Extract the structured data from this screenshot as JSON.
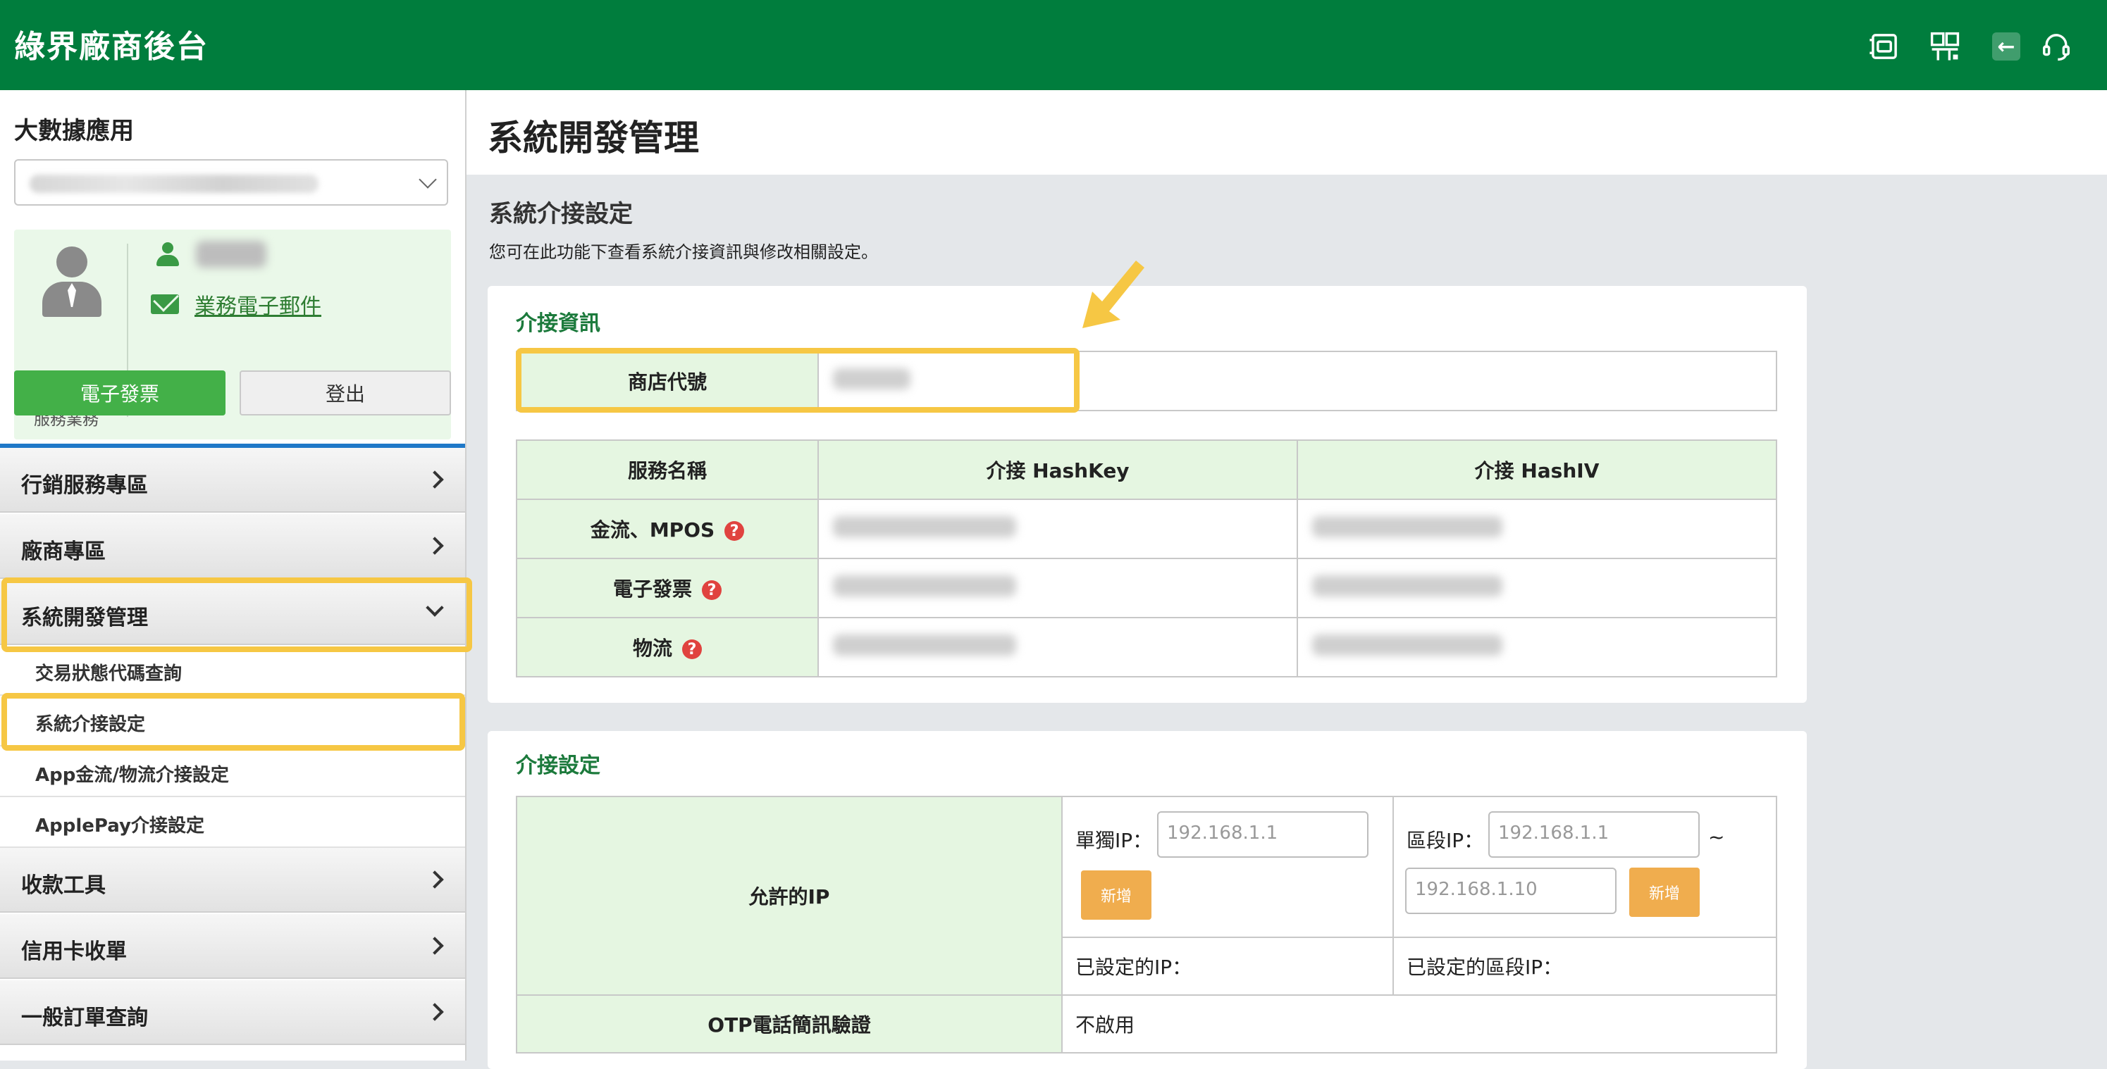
{
  "header": {
    "brand": "綠界廠商後台",
    "icons": [
      "invoice-app-icon",
      "qr-code-icon",
      "back-icon",
      "support-headset-icon"
    ],
    "brand_color": "#007d3d"
  },
  "sidebar": {
    "title": "大數據應用",
    "select_value": "",
    "card": {
      "role_label": "服務業務",
      "email_link": "業務電子郵件"
    },
    "buttons": {
      "invoice": "電子發票",
      "logout": "登出"
    },
    "menu": [
      {
        "label": "行銷服務專區",
        "expanded": false
      },
      {
        "label": "廠商專區",
        "expanded": false
      },
      {
        "label": "系統開發管理",
        "expanded": true,
        "children": [
          "交易狀態代碼查詢",
          "系統介接設定",
          "App金流/物流介接設定",
          "ApplePay介接設定"
        ]
      },
      {
        "label": "收款工具",
        "expanded": false
      },
      {
        "label": "信用卡收單",
        "expanded": false
      },
      {
        "label": "一般訂單查詢",
        "expanded": false
      }
    ],
    "highlight_color": "#f6c744"
  },
  "main": {
    "page_title": "系統開發管理",
    "section_title": "系統介接設定",
    "section_desc": "您可在此功能下查看系統介接資訊與修改相關設定。",
    "info_panel": {
      "title": "介接資訊",
      "store_id_label": "商店代號",
      "table_headers": [
        "服務名稱",
        "介接 HashKey",
        "介接 HashIV"
      ],
      "rows": [
        {
          "name": "金流、MPOS"
        },
        {
          "name": "電子發票"
        },
        {
          "name": "物流"
        }
      ]
    },
    "settings_panel": {
      "title": "介接設定",
      "allowed_ip_label": "允許的IP",
      "single_ip_label": "單獨IP：",
      "single_ip_placeholder": "192.168.1.1",
      "range_ip_label": "區段IP：",
      "range_ip_from_placeholder": "192.168.1.1",
      "range_ip_to_placeholder": "192.168.1.10",
      "range_sep": "~",
      "add_button": "新增",
      "set_ip_label": "已設定的IP：",
      "set_range_ip_label": "已設定的區段IP：",
      "otp_label": "OTP電話簡訊驗證",
      "otp_value": "不啟用"
    }
  }
}
